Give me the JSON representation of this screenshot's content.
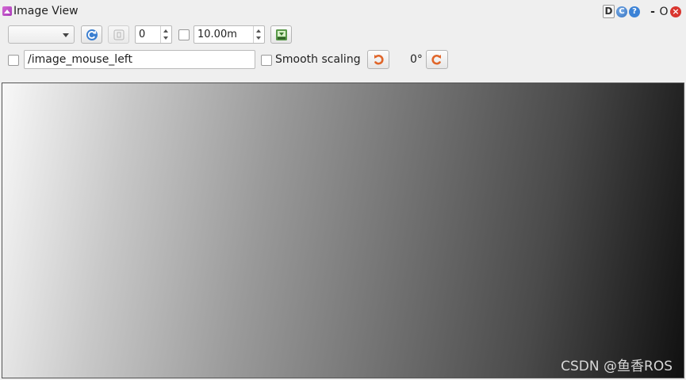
{
  "window": {
    "title": "Image View",
    "title_buttons": {
      "d_label": "D",
      "help_label": "?",
      "minimize_label": "-",
      "maximize_label": "O",
      "close_label": "×"
    }
  },
  "toolbar": {
    "topic_combo_value": "",
    "number_spin_value": "0",
    "distance_spin_value": "10.00m",
    "topic_field_value": "/image_mouse_left",
    "smooth_scaling_label": "Smooth scaling",
    "rotation_label": "0°"
  },
  "image_area": {
    "watermark": "CSDN @鱼香ROS"
  },
  "colors": {
    "background": "#efefef",
    "refresh_icon": "#3b7fd1",
    "rotate_icon": "#e0662a",
    "close_button": "#d9362f"
  },
  "icons": {
    "app": "app-icon",
    "refresh": "refresh-icon",
    "zoom_reset": "zoom-icon",
    "save": "save-image-icon",
    "rotate_left": "rotate-left-icon",
    "rotate_right": "rotate-right-icon"
  }
}
